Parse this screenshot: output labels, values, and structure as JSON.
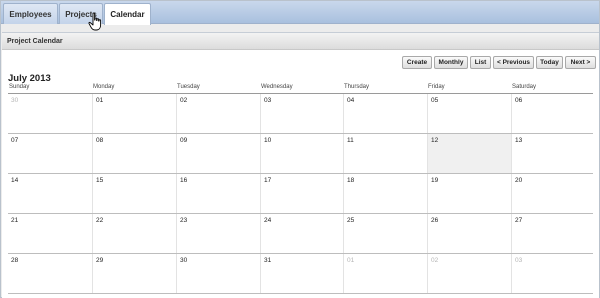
{
  "tabs": [
    {
      "label": "Employees"
    },
    {
      "label": "Projects"
    },
    {
      "label": "Calendar"
    }
  ],
  "panel": {
    "title": "Project Calendar"
  },
  "toolbar": {
    "create": "Create",
    "monthly": "Monthly",
    "list": "List",
    "previous": "< Previous",
    "today": "Today",
    "next": "Next >"
  },
  "calendar": {
    "month_title": "July 2013",
    "days_of_week": [
      "Sunday",
      "Monday",
      "Tuesday",
      "Wednesday",
      "Thursday",
      "Friday",
      "Saturday"
    ],
    "weeks": [
      [
        "30",
        "01",
        "02",
        "03",
        "04",
        "05",
        "06"
      ],
      [
        "07",
        "08",
        "09",
        "10",
        "11",
        "12",
        "13"
      ],
      [
        "14",
        "15",
        "16",
        "17",
        "18",
        "19",
        "20"
      ],
      [
        "21",
        "22",
        "23",
        "24",
        "25",
        "26",
        "27"
      ],
      [
        "28",
        "29",
        "30",
        "31",
        "01",
        "02",
        "03"
      ]
    ],
    "other_month_cells": [
      [
        0,
        0
      ],
      [
        4,
        4
      ],
      [
        4,
        5
      ],
      [
        4,
        6
      ]
    ],
    "highlighted_cell": [
      1,
      5
    ]
  },
  "colors": {
    "tabbar": "#b7cbe6",
    "active_tab": "#ffffff",
    "today_bg": "#f0f0f0",
    "other_month_text": "#b5b5b5"
  }
}
